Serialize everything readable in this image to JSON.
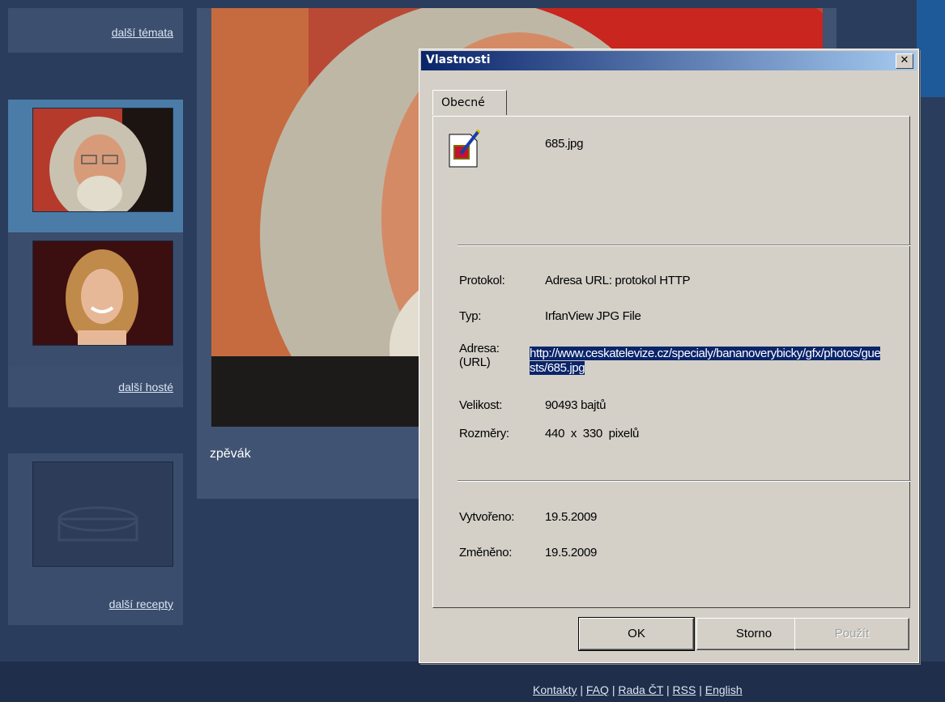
{
  "sidebar": {
    "more_topics": "další témata",
    "more_guests": "další hosté",
    "more_recipes": "další recepty"
  },
  "main": {
    "caption": "zpěvák"
  },
  "footer": {
    "links": [
      "Kontakty",
      "FAQ",
      "Rada ČT",
      "RSS",
      "English"
    ],
    "separator": "|"
  },
  "dialog": {
    "title": "Vlastnosti",
    "close_glyph": "✕",
    "tab": "Obecné",
    "filename": "685.jpg",
    "file_icon": "image-file-icon",
    "fields": {
      "protocol_label": "Protokol:",
      "protocol_value": "Adresa URL: protokol HTTP",
      "type_label": "Typ:",
      "type_value": "IrfanView JPG File",
      "address_label": "Adresa:\n(URL)",
      "address_value": "http://www.ceskatelevize.cz/specialy/bananoverybicky/gfx/photos/guests/685.jpg",
      "size_label": "Velikost:",
      "size_value": "90493 bajtů",
      "dimensions_label": "Rozměry:",
      "dimensions_value": "440  x  330  pixelů",
      "created_label": "Vytvořeno:",
      "created_value": "19.5.2009",
      "modified_label": "Změněno:",
      "modified_value": "19.5.2009"
    },
    "buttons": {
      "ok": "OK",
      "cancel": "Storno",
      "apply": "Použít"
    }
  },
  "colors": {
    "background": "#2b3d5c",
    "titlebar": "#0a246a",
    "selection": "#0a246a"
  }
}
